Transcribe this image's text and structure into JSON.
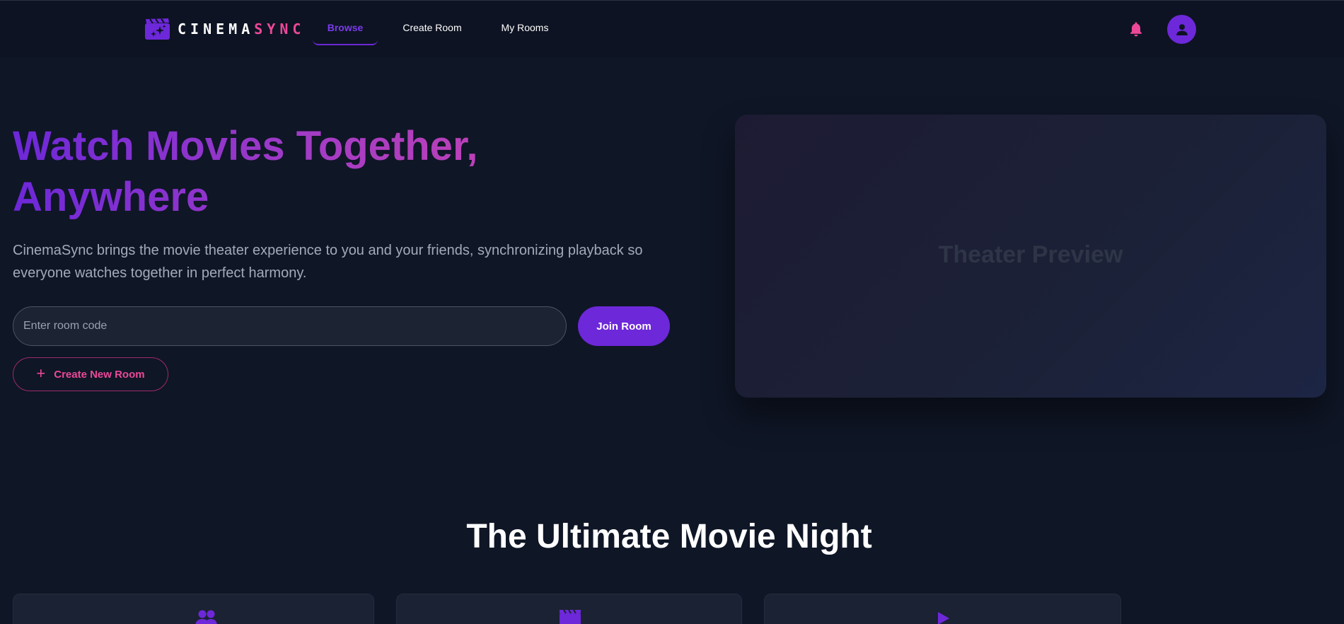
{
  "brand": {
    "name_part1": "CINEMA",
    "name_part2": "SYNC",
    "icon": "clapperboard-sparkle-icon"
  },
  "nav": {
    "links": [
      {
        "label": "Browse",
        "active": true
      },
      {
        "label": "Create Room",
        "active": false
      },
      {
        "label": "My Rooms",
        "active": false
      }
    ],
    "notification_icon": "bell-icon",
    "avatar_icon": "user-icon"
  },
  "hero": {
    "title_line1": "Watch Movies Together,",
    "title_line2": "Anywhere",
    "subtitle": "CinemaSync brings the movie theater experience to you and your friends, synchronizing playback so everyone watches together in perfect harmony.",
    "room_code_placeholder": "Enter room code",
    "room_code_value": "",
    "join_button": "Join Room",
    "create_button": "Create New Room",
    "create_icon": "plus-icon"
  },
  "preview": {
    "label": "Theater Preview"
  },
  "features": {
    "title": "The Ultimate Movie Night",
    "cards": [
      {
        "icon": "users-icon"
      },
      {
        "icon": "film-icon"
      },
      {
        "icon": "play-icon"
      }
    ]
  },
  "colors": {
    "background": "#0f1626",
    "accent_purple": "#6d28d9",
    "accent_pink": "#ec4899",
    "card": "#1b2233"
  }
}
